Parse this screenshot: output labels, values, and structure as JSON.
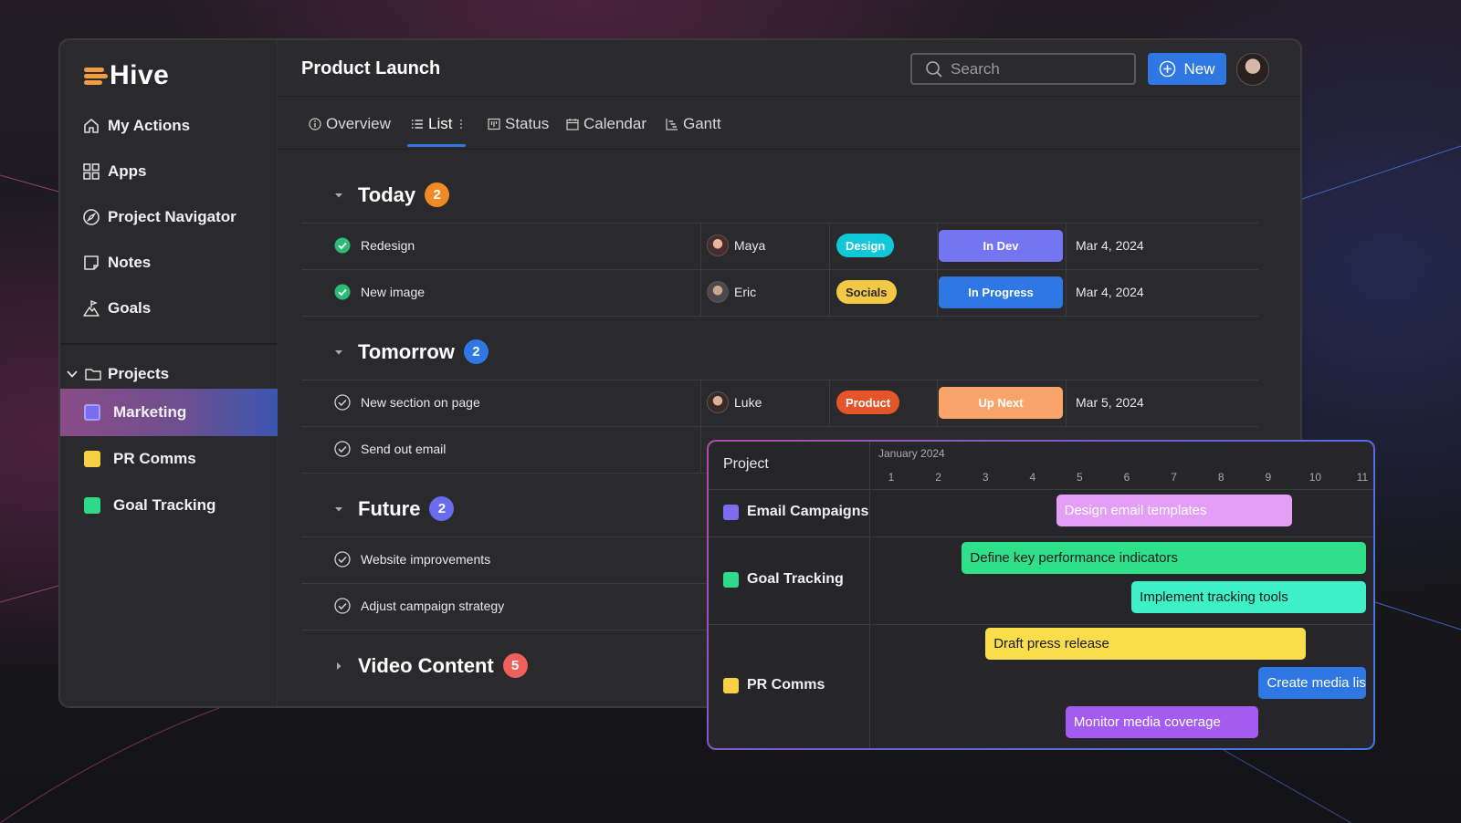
{
  "app": {
    "name": "Hive"
  },
  "sidebar": {
    "items": [
      {
        "label": "My Actions",
        "icon": "home-icon"
      },
      {
        "label": "Apps",
        "icon": "grid-icon"
      },
      {
        "label": "Project Navigator",
        "icon": "compass-icon"
      },
      {
        "label": "Notes",
        "icon": "note-icon"
      },
      {
        "label": "Goals",
        "icon": "mountain-flag-icon"
      }
    ],
    "projects_label": "Projects",
    "projects": [
      {
        "label": "Marketing",
        "color": "#7b6cf0",
        "active": true
      },
      {
        "label": "PR Comms",
        "color": "#f7d046",
        "active": false
      },
      {
        "label": "Goal Tracking",
        "color": "#2fd98a",
        "active": false
      }
    ]
  },
  "header": {
    "title": "Product Launch",
    "search_placeholder": "Search",
    "new_label": "New"
  },
  "tabs": [
    {
      "label": "Overview",
      "icon": "info-icon"
    },
    {
      "label": "List",
      "icon": "list-icon",
      "active": true
    },
    {
      "label": "Status",
      "icon": "kanban-icon"
    },
    {
      "label": "Calendar",
      "icon": "calendar-icon"
    },
    {
      "label": "Gantt",
      "icon": "gantt-icon"
    }
  ],
  "groups": [
    {
      "name": "Today",
      "count": "2",
      "badge_color": "#f08a24",
      "expanded": true,
      "tasks": [
        {
          "title": "Redesign",
          "done": true,
          "assignee": "Maya",
          "tag": "Design",
          "tag_color": "#11c8d8",
          "status": "In Dev",
          "status_color": "#7475f0",
          "date": "Mar 4, 2024"
        },
        {
          "title": "New image",
          "done": true,
          "assignee": "Eric",
          "tag": "Socials",
          "tag_color": "#f3c845",
          "status": "In Progress",
          "status_color": "#2f78e4",
          "date": "Mar 4, 2024"
        }
      ]
    },
    {
      "name": "Tomorrow",
      "count": "2",
      "badge_color": "#2f78e4",
      "expanded": true,
      "tasks": [
        {
          "title": "New section on page",
          "done": false,
          "assignee": "Luke",
          "tag": "Product",
          "tag_color": "#e5552a",
          "status": "Up Next",
          "status_color": "#f9a46a",
          "date": "Mar 5, 2024"
        },
        {
          "title": "Send out email",
          "done": false
        }
      ]
    },
    {
      "name": "Future",
      "count": "2",
      "badge_color": "#6a6cf0",
      "expanded": true,
      "tasks": [
        {
          "title": "Website improvements",
          "done": false
        },
        {
          "title": "Adjust campaign strategy",
          "done": false
        }
      ]
    },
    {
      "name": "Video Content",
      "count": "5",
      "badge_color": "#f0605a",
      "expanded": false,
      "tasks": []
    }
  ],
  "gantt": {
    "project_header": "Project",
    "month": "January 2024",
    "days": [
      "1",
      "2",
      "3",
      "4",
      "5",
      "6",
      "7",
      "8",
      "9",
      "10",
      "11"
    ],
    "rows": [
      {
        "name": "Email Campaigns",
        "color": "#7b6cf0",
        "bars": [
          {
            "label": "Design email templates",
            "start": 4.5,
            "end": 9.5,
            "color": "#e59ef5",
            "text_color": "#ffffff"
          }
        ]
      },
      {
        "name": "Goal Tracking",
        "color": "#2fd98a",
        "bars": [
          {
            "label": "Define key performance indicators",
            "start": 2.5,
            "end": 11.8,
            "color": "#2fe08a",
            "text_color": "#1a1a1a"
          },
          {
            "label": "Implement tracking tools",
            "start": 6.1,
            "end": 11.6,
            "color": "#3ef0c8",
            "text_color": "#1a1a1a"
          }
        ]
      },
      {
        "name": "PR Comms",
        "color": "#f7d046",
        "bars": [
          {
            "label": "Draft press release",
            "start": 3.0,
            "end": 9.8,
            "color": "#f9dd4a",
            "text_color": "#1a1a1a"
          },
          {
            "label": "Create media list",
            "start": 8.8,
            "end": 12.5,
            "color": "#2f78e4",
            "text_color": "#ffffff"
          },
          {
            "label": "Monitor media coverage",
            "start": 4.7,
            "end": 8.8,
            "color": "#a45cf0",
            "text_color": "#ffffff"
          }
        ]
      }
    ]
  }
}
